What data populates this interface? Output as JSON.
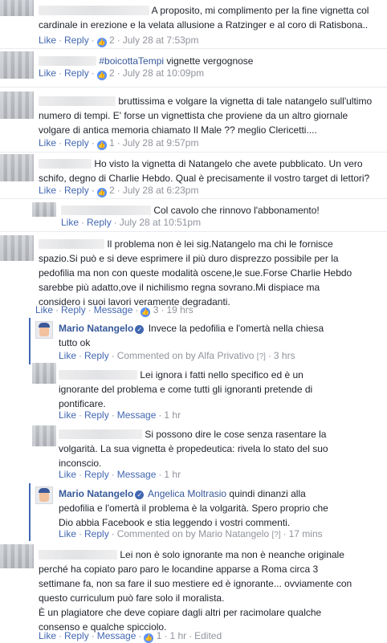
{
  "actions": {
    "like": "Like",
    "reply": "Reply",
    "message": "Message",
    "sep": "·"
  },
  "comments": [
    {
      "lines": [
        "A proposito, mi complimento per la fine vignetta col",
        "cardinale in erezione e la velata allusione a Ratzinger e al coro di Ratisbona.."
      ],
      "likes": "2",
      "time": "July 28 at 7:53pm"
    },
    {
      "hashtag": "#boicottaTempi",
      "text": " vignette vergognose",
      "likes": "2",
      "time": "July 28 at 10:09pm"
    },
    {
      "lines": [
        "bruttissima e volgare la vignetta di tale natangelo sull'ultimo",
        "numero di tempi. E' forse un vignettista che proviene da un altro giornale",
        "volgare di antica memoria chiamato Il Male ?? meglio Clericetti...."
      ],
      "likes": "1",
      "time": "July 28 at 9:57pm"
    },
    {
      "lines": [
        "Ho visto la vignetta di Natangelo che avete pubblicato. Un vero",
        "schifo, degno di Charlie Hebdo. Qual è precisamente il vostro target di lettori?"
      ],
      "likes": "2",
      "time": "July 28 at 6:23pm"
    },
    {
      "lines": [
        "Col cavolo che rinnovo l'abbonamento!"
      ],
      "time": "July 28 at 10:51pm"
    },
    {
      "lines": [
        "Il problema non è lei sig.Natangelo ma chi le fornisce",
        "spazio.Si può e si deve esprimere il più duro disprezzo possibile per la",
        "pedofilia ma non con queste modalità oscene,le sue.Forse Charlie Hebdo",
        "sarebbe più adatto,ove il nichilismo regna sovrano.Mi dispiace ma",
        "considero i suoi lavori veramente degradanti."
      ],
      "likes": "3",
      "time": "19 hrs"
    }
  ],
  "replies": [
    {
      "author": "Mario Natangelo",
      "lines": [
        "Invece la pedofilia e l'omertà nella chiesa",
        "tutto ok"
      ],
      "commented_on": "Commented on by Alfa Privativo",
      "q": "[?]",
      "time": "3 hrs"
    },
    {
      "lines": [
        "Lei ignora i fatti nello specifico ed è un",
        "ignorante del problema e come tutti gli ignoranti pretende di",
        "pontificare."
      ],
      "time": "1 hr"
    },
    {
      "lines": [
        "Si possono dire le cose senza rasentare la",
        "volgarità. La sua vignetta è propedeutica: rivela lo stato del suo",
        "inconscio."
      ],
      "time": "1 hr"
    },
    {
      "author": "Mario Natangelo",
      "tag": "Angelica Moltrasio",
      "lines": [
        " quindi dinanzi alla",
        "pedofilia e l'omertà il problema è la volgarità. Spero proprio che",
        "Dio abbia Facebook e stia leggendo i vostri commenti."
      ],
      "commented_on": "Commented on by Mario Natangelo",
      "q": "[?]",
      "time": "17 mins"
    }
  ],
  "last": {
    "lines": [
      "Lei non è solo ignorante ma non è neanche originale",
      "perché ha copiato paro paro le locandine apparse a Roma circa 3",
      "settimane fa, non sa fare il suo mestiere ed è ignorante... ovviamente con",
      "questo curriculum può fare solo il moralista.",
      "È un plagiatore che deve copiare dagli altri per racimolare qualche",
      "consenso e qualche spicciolo."
    ],
    "likes": "1",
    "time": "1 hr",
    "edited": "Edited"
  },
  "icons": {
    "like_badge": "thumbs-up-icon",
    "verified": "verified-check-icon"
  },
  "colors": {
    "link": "#4267b2",
    "author": "#365899",
    "meta": "#90949c",
    "reply_bar": "#4267b2"
  }
}
